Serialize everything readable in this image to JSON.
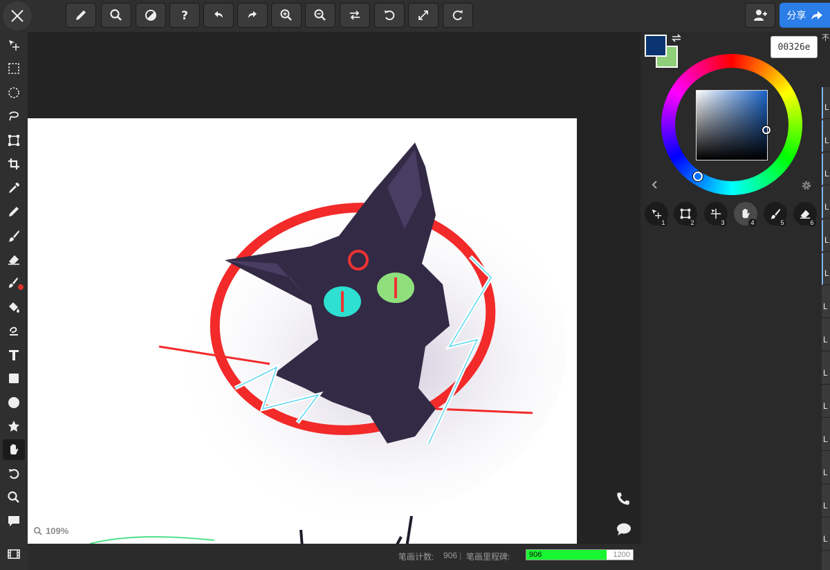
{
  "toolbar": {
    "buttons": [
      "pencil",
      "zoom",
      "contrast",
      "help",
      "undo",
      "redo",
      "zoom-in",
      "zoom-out",
      "flip",
      "rotate-left",
      "fullscreen",
      "rotate-right"
    ],
    "share_label": "分享"
  },
  "left_tools": [
    "move-select",
    "rect-select",
    "ellipse-select",
    "lasso-select",
    "transform",
    "crop",
    "eyedropper",
    "pencil",
    "brush",
    "eraser",
    "smudge",
    "fill",
    "blur",
    "text",
    "rectangle",
    "circle",
    "star",
    "hand",
    "rotate",
    "zoom",
    "comment",
    "film"
  ],
  "canvas": {
    "zoom": "109%"
  },
  "status": {
    "stroke_count_label": "笔画计数:",
    "stroke_count": "906",
    "milestone_label": "笔画里程碑:",
    "milestone_value": "906",
    "milestone_max": "1200",
    "milestone_progress": 0.755
  },
  "color": {
    "hex": "00326e",
    "primary": "#0a3570",
    "secondary": "#8fcf7a"
  },
  "hand_tools": [
    {
      "icon": "move-icon",
      "num": "1"
    },
    {
      "icon": "transform-icon",
      "num": "2"
    },
    {
      "icon": "move-select-icon",
      "num": "3"
    },
    {
      "icon": "hand-icon",
      "num": "4"
    },
    {
      "icon": "brush-icon",
      "num": "5"
    },
    {
      "icon": "eraser-icon",
      "num": "6"
    }
  ],
  "layers": {
    "header": "不",
    "rows": [
      "L",
      "L",
      "L",
      "L",
      "L",
      "L",
      "L",
      "L",
      "L",
      "L",
      "L",
      "L",
      "L",
      "L"
    ]
  }
}
